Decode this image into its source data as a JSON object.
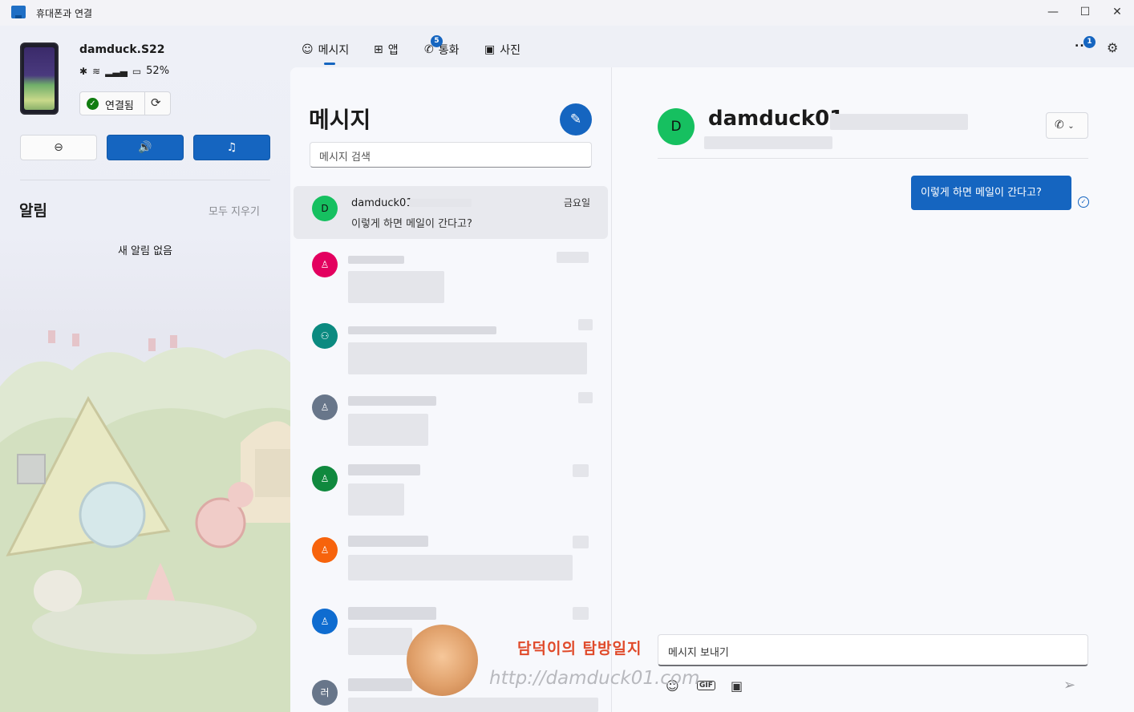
{
  "window": {
    "title": "휴대폰과 연결",
    "minimize": "—",
    "maximize": "☐",
    "close": "✕"
  },
  "device": {
    "name": "damduck.S22",
    "battery": "52%",
    "connected_label": "연결됨"
  },
  "quick_actions": {
    "dnd_icon": "⊖",
    "audio_icon": "🔊",
    "music_icon": "♫"
  },
  "notifications": {
    "title": "알림",
    "clear_all": "모두 지우기",
    "empty": "새 알림 없음"
  },
  "tabs": [
    {
      "label": "메시지",
      "icon": "message-icon",
      "badge": ""
    },
    {
      "label": "앱",
      "icon": "apps-icon",
      "badge": ""
    },
    {
      "label": "통화",
      "icon": "phone-icon",
      "badge": "5"
    },
    {
      "label": "사진",
      "icon": "photo-icon",
      "badge": ""
    }
  ],
  "header_right": {
    "more": "...",
    "more_badge": "1"
  },
  "messages": {
    "title": "메시지",
    "search_placeholder": "메시지 검색",
    "conversations": [
      {
        "avatar": "D",
        "name": "damduck01",
        "preview": "이렇게 하면 메일이 간다고?",
        "date": "금요일",
        "color": "#16c060"
      },
      {
        "avatar": "",
        "color": "#e3005f"
      },
      {
        "avatar": "",
        "color": "#0b8a80"
      },
      {
        "avatar": "",
        "color": "#68768a"
      },
      {
        "avatar": "",
        "color": "#10893e"
      },
      {
        "avatar": "",
        "color": "#f7630c"
      },
      {
        "avatar": "",
        "color": "#0f6cd0"
      },
      {
        "avatar": "러",
        "color": "#68768a"
      }
    ]
  },
  "conversation": {
    "avatar": "D",
    "name": "damduck01",
    "bubble": "이렇게 하면 메일이 간다고?",
    "compose_placeholder": "메시지 보내기",
    "gif_label": "GIF"
  },
  "watermark": {
    "title": "담덕이의 탐방일지",
    "url": "http://damduck01.com"
  }
}
